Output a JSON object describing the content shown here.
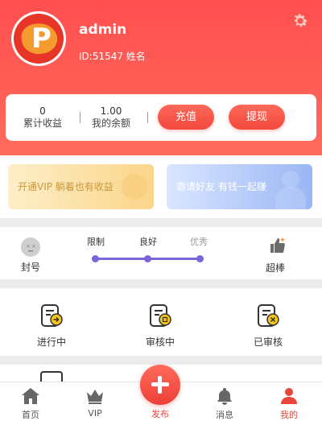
{
  "profile": {
    "username": "admin",
    "id_line": "ID:51547 姓名"
  },
  "balance": {
    "earnings_value": "0",
    "earnings_label": "累计收益",
    "balance_value": "1.00",
    "balance_label": "我的余额",
    "recharge_label": "充值",
    "withdraw_label": "提现"
  },
  "banners": {
    "vip_text": "开通VIP 躺着也有收益",
    "invite_text": "邀请好友 有钱一起赚"
  },
  "rating": {
    "left_label": "封号",
    "levels": [
      "限制",
      "良好",
      "优秀"
    ],
    "right_label": "超棒"
  },
  "orders": [
    {
      "label": "进行中",
      "icon": "arrow-right-icon"
    },
    {
      "label": "审核中",
      "icon": "stamp-icon"
    },
    {
      "label": "已审核",
      "icon": "close-circle-icon"
    }
  ],
  "tabbar": {
    "home": "首页",
    "vip": "VIP",
    "publish": "发布",
    "messages": "消息",
    "mine": "我的"
  },
  "colors": {
    "primary": "#ff5252",
    "accent_purple": "#7b63d8",
    "badge_yellow": "#f5c518"
  }
}
